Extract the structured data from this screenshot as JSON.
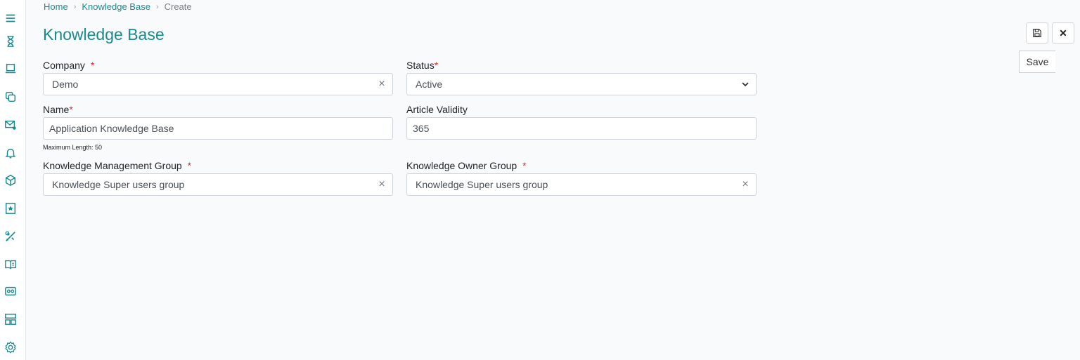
{
  "breadcrumb": {
    "home": "Home",
    "section": "Knowledge Base",
    "current": "Create",
    "separator": "›"
  },
  "page": {
    "title": "Knowledge Base"
  },
  "toolbar": {
    "save_tooltip": "Save",
    "save_icon": "floppy-disk-icon",
    "close_icon": "close-icon"
  },
  "sidebar": {
    "icons": [
      "menu-icon",
      "hourglass-icon",
      "laptop-icon",
      "copy-icon",
      "mail-settings-icon",
      "bell-icon",
      "cube-icon",
      "bookmark-star-icon",
      "tools-icon",
      "book-icon",
      "badge-icon",
      "layout-icon",
      "settings-icon"
    ]
  },
  "form": {
    "company": {
      "label": "Company",
      "required_mark": "*",
      "value": "Demo"
    },
    "status": {
      "label": "Status",
      "required_mark": "*",
      "value": "Active"
    },
    "name": {
      "label": "Name",
      "required_mark": "*",
      "value": "Application Knowledge Base",
      "hint": "Maximum Length: 50"
    },
    "article_validity": {
      "label": "Article Validity",
      "value": "365"
    },
    "km_group": {
      "label": "Knowledge Management Group",
      "required_mark": "*",
      "value": "Knowledge Super users group"
    },
    "owner_group": {
      "label": "Knowledge Owner Group",
      "required_mark": "*",
      "value": "Knowledge Super users group"
    },
    "clear_symbol": "×"
  },
  "colors": {
    "accent": "#1a8a8f",
    "required": "#d32f2f",
    "background": "#f8fafc"
  }
}
